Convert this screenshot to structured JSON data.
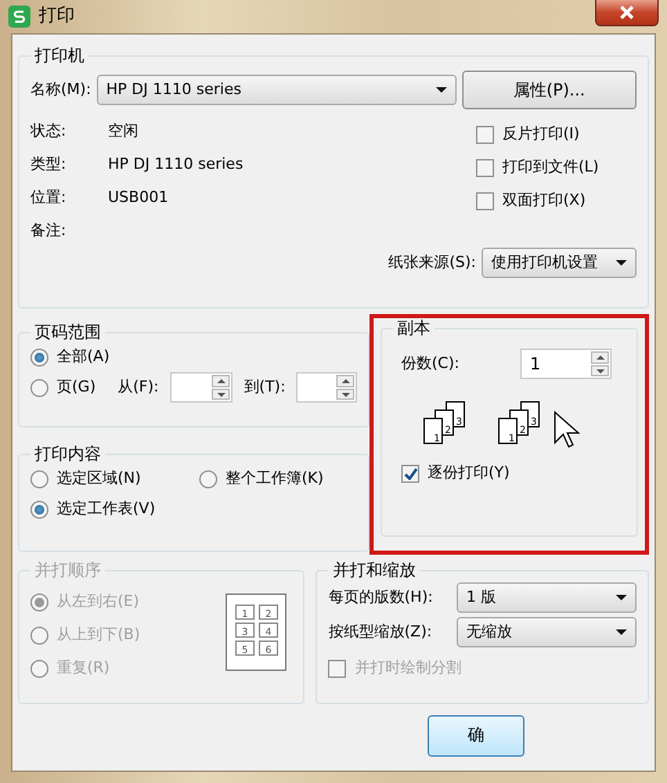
{
  "window": {
    "title": "打印"
  },
  "printer": {
    "title": "打印机",
    "name_label": "名称(M):",
    "name_value": "HP DJ 1110 series",
    "properties_button": "属性(P)...",
    "info": [
      {
        "label": "状态:",
        "value": "空闲"
      },
      {
        "label": "类型:",
        "value": "HP DJ 1110 series"
      },
      {
        "label": "位置:",
        "value": "USB001"
      },
      {
        "label": "备注:"
      }
    ],
    "options": [
      {
        "label": "反片打印(I)",
        "checked": false
      },
      {
        "label": "打印到文件(L)",
        "checked": false
      },
      {
        "label": "双面打印(X)",
        "checked": false
      }
    ],
    "paper_source": {
      "label": "纸张来源(S):",
      "value": "使用打印机设置"
    }
  },
  "page_range": {
    "title": "页码范围",
    "options": [
      {
        "label": "全部(A)",
        "selected": true
      },
      {
        "label": "页(G)",
        "selected": false
      }
    ],
    "from_label": "从(F):",
    "to_label": "到(T):"
  },
  "print_content": {
    "title": "打印内容",
    "options": [
      {
        "label": "选定区域(N)",
        "selected": false
      },
      {
        "label": "整个工作簿(K)",
        "selected": false
      },
      {
        "label": "选定工作表(V)",
        "selected": true
      }
    ]
  },
  "copies": {
    "title": "副本",
    "highlighted": true,
    "count_label": "份数(C):",
    "count_value": "1",
    "collate_icons": [
      [
        "1",
        "2",
        "3"
      ],
      [
        "1",
        "2",
        "3"
      ]
    ],
    "collate": {
      "label": "逐份打印(Y)",
      "checked": true
    }
  },
  "order": {
    "title": "并打顺序",
    "disabled": true,
    "options": [
      {
        "label": "从左到右(E)",
        "selected": true
      },
      {
        "label": "从上到下(B)",
        "selected": false
      },
      {
        "label": "重复(R)",
        "selected": false
      }
    ],
    "preview": [
      "1",
      "2",
      "3",
      "4",
      "5",
      "6"
    ]
  },
  "merge": {
    "title": "并打和缩放",
    "pages_label": "每页的版数(H):",
    "pages_value": "1 版",
    "scale_label": "按纸型缩放(Z):",
    "scale_value": "无缩放",
    "divider": {
      "label": "并打时绘制分割",
      "checked": false,
      "disabled": true
    }
  },
  "buttons": [
    "确"
  ]
}
